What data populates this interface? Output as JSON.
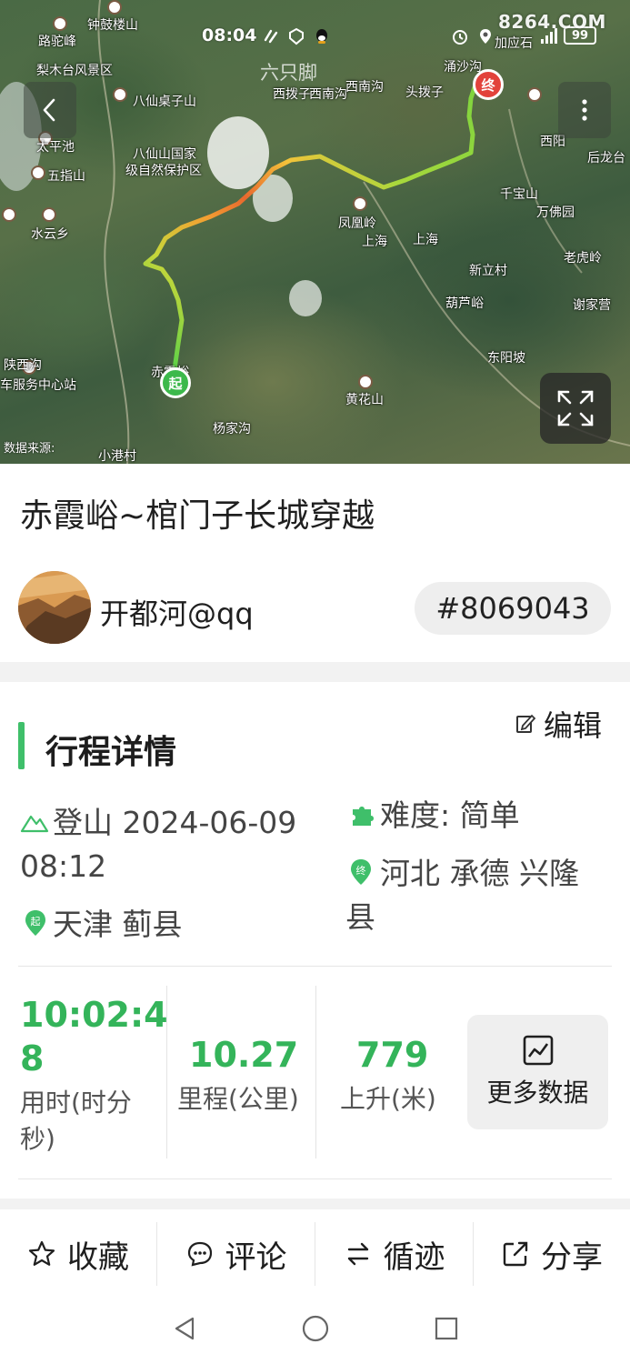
{
  "status_bar": {
    "time": "08:04",
    "battery": "99",
    "watermark": "8264.COM"
  },
  "map": {
    "logo_text": "六只脚",
    "data_source": "数据来源:",
    "start_marker": "起",
    "end_marker": "终",
    "labels": {
      "l1": "钟鼓楼山",
      "l2": "路驼峰",
      "l3": "梨木台风景区",
      "l4": "八仙桌子山",
      "l5": "太平池",
      "l6": "五指山",
      "l7": "八仙山国家",
      "l8": "级自然保护区",
      "l9": "水云乡",
      "l10": "车服务中心站",
      "l11": "西拨子",
      "l12": "西南沟",
      "l13": "西南沟",
      "l14": "头拨子",
      "l15": "凤凰岭",
      "l16": "上海",
      "l17": "上海",
      "l18": "新立村",
      "l19": "千宝山",
      "l20": "万佛园",
      "l21": "老虎岭",
      "l22": "后龙台",
      "l23": "谢家营",
      "l24": "黄花山",
      "l25": "杨家沟",
      "l26": "小港村",
      "l27": "加应石",
      "l28": "涌沙沟",
      "l29": "西阳",
      "l30": "葫芦峪",
      "l31": "东阳坡",
      "l32": "赤霞峪",
      "l33": "陕西沟"
    }
  },
  "trip": {
    "title": "赤霞峪~棺门子长城穿越",
    "author": "开都河@qq",
    "track_id": "#8069043"
  },
  "details": {
    "section_title": "行程详情",
    "edit_label": "编辑",
    "activity_line1": "登山 2024-06-09",
    "activity_line2": "08:12",
    "difficulty": "难度: 简单",
    "start_place": "天津 蓟县",
    "end_place_line1": "河北 承德 兴隆",
    "end_place_line2": "县",
    "start_badge": "起",
    "end_badge": "终"
  },
  "stats": {
    "duration_line1": "10:02:4",
    "duration_line2": "8",
    "duration_label_line1": "用时(时分",
    "duration_label_line2": "秒)",
    "distance": "10.27",
    "distance_label": "里程(公里)",
    "ascent": "779",
    "ascent_label": "上升(米)",
    "more_label": "更多数据"
  },
  "toolbar": {
    "favorite": "收藏",
    "comment": "评论",
    "follow_track": "循迹",
    "share": "分享"
  },
  "colors": {
    "accent_green": "#34b45a",
    "section_bar": "#3fbf6a",
    "end_red": "#e2423b"
  }
}
